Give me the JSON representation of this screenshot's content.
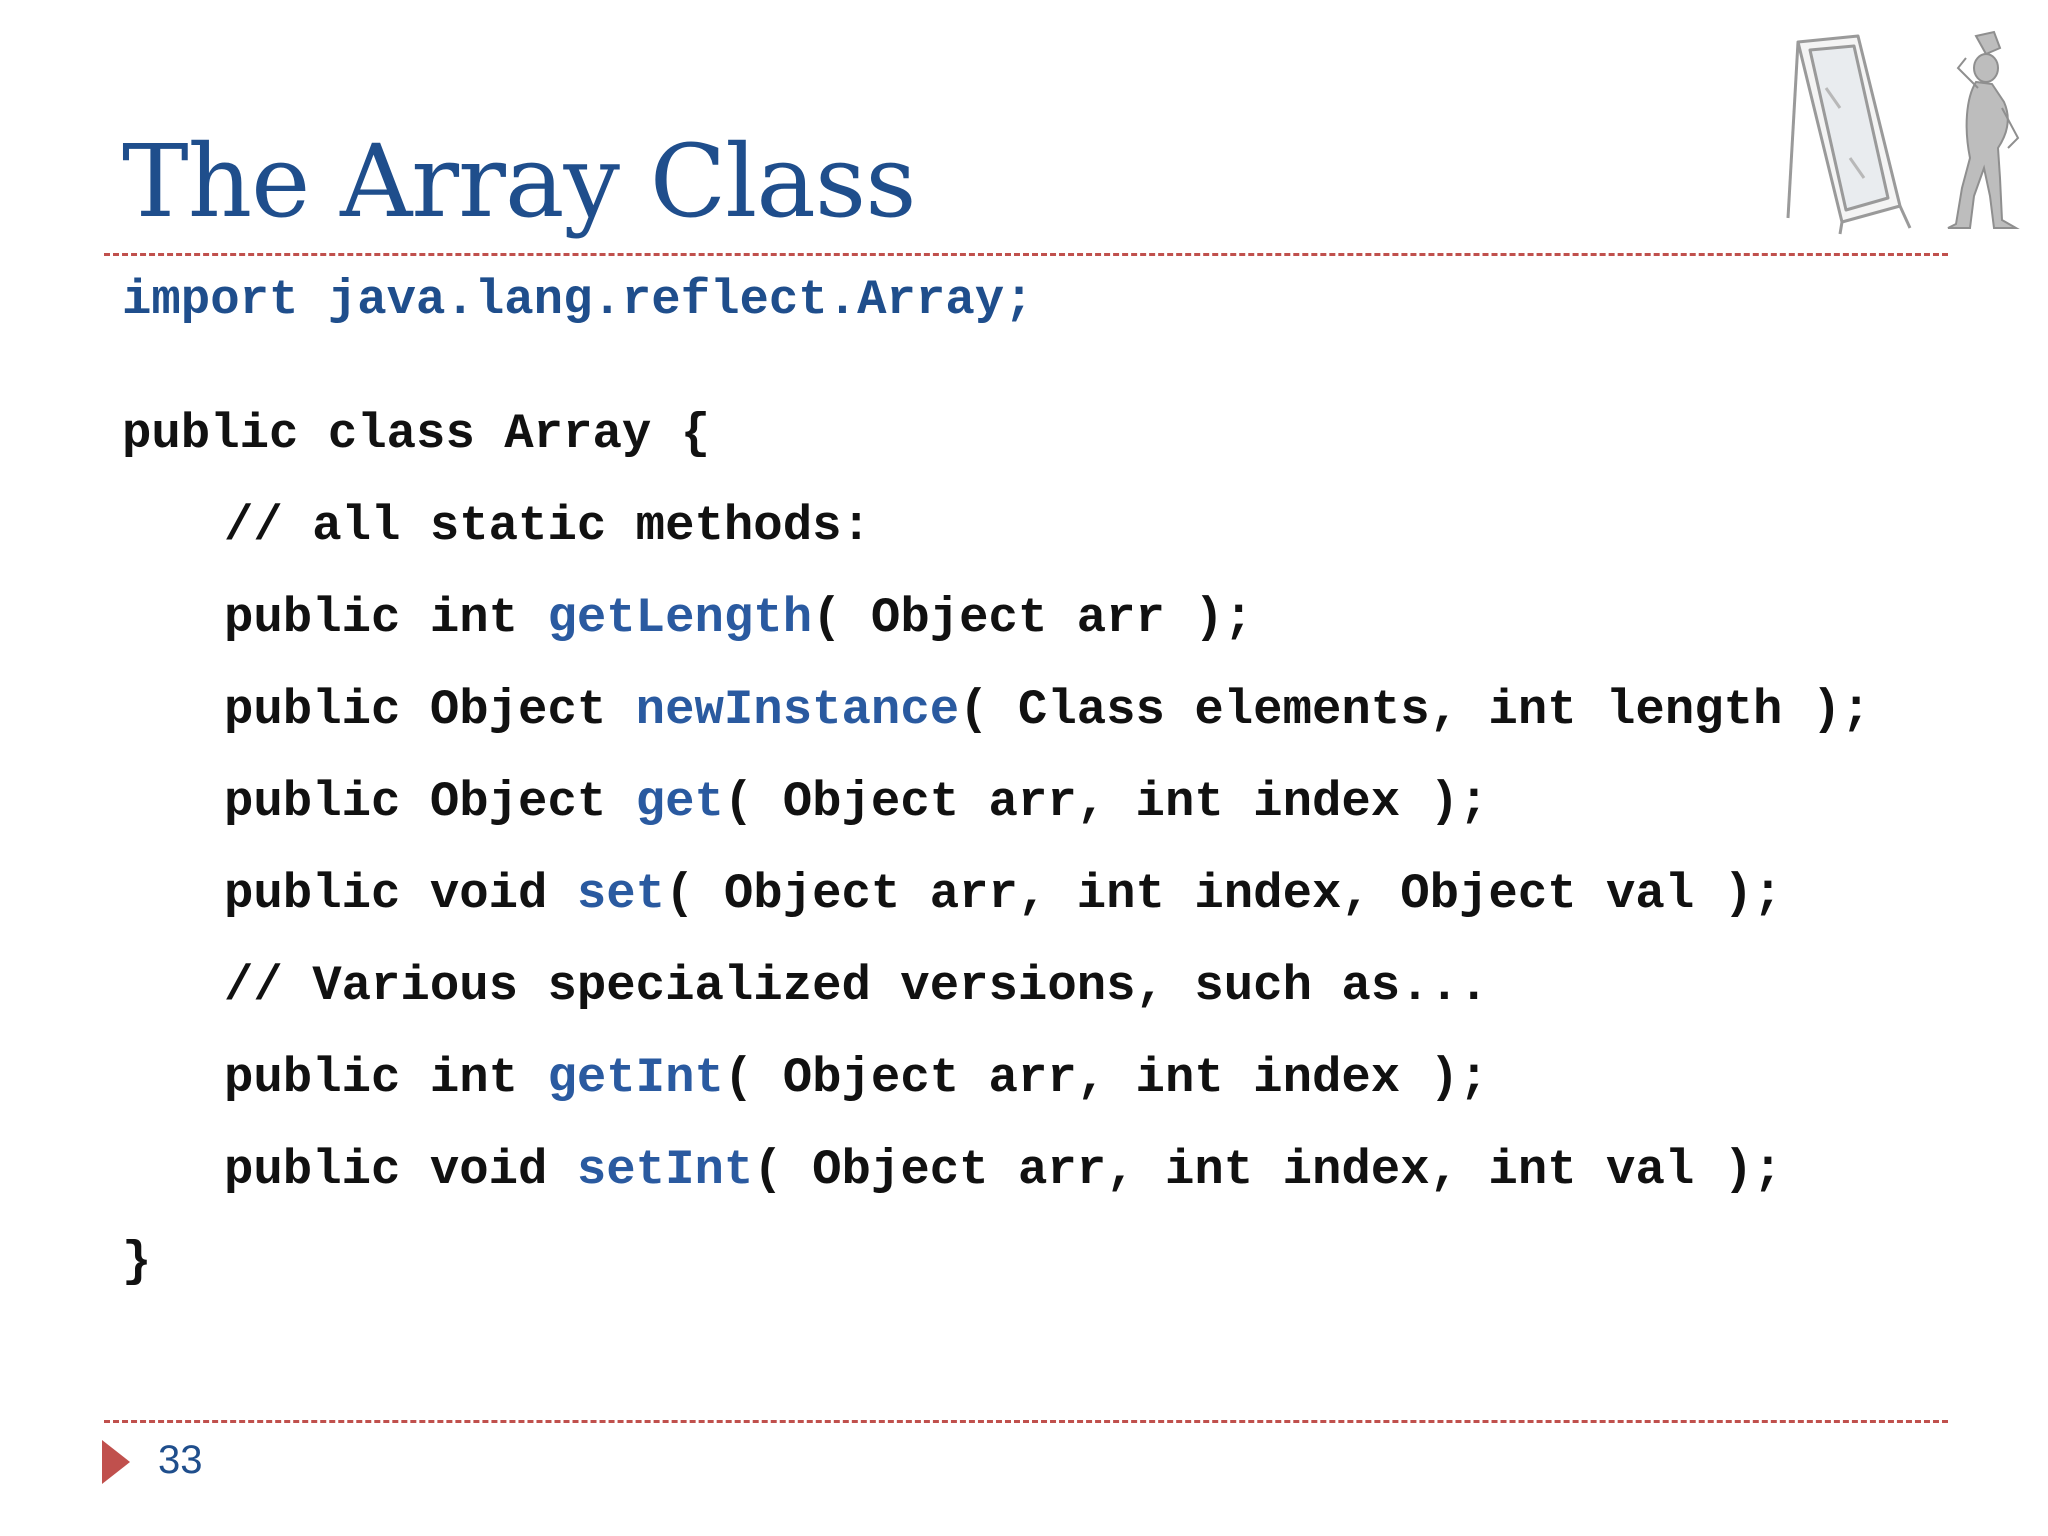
{
  "slide": {
    "title": "The Array Class",
    "page_number": "33"
  },
  "code": {
    "import_line": "import java.lang.reflect.Array;",
    "class_decl": "public class Array {",
    "comment_static": "// all static methods:",
    "methods": [
      {
        "prefix": "public int ",
        "name": "getLength",
        "params": "( Object arr );"
      },
      {
        "prefix": "public Object ",
        "name": "newInstance",
        "params": "( Class elements, int length );"
      },
      {
        "prefix": "public Object ",
        "name": "get",
        "params": "( Object arr, int index );"
      },
      {
        "prefix": "public void ",
        "name": "set",
        "params": "( Object arr, int index, Object val );"
      }
    ],
    "comment_specialized": "// Various specialized versions, such as...",
    "special_methods": [
      {
        "prefix": "public int ",
        "name": "getInt",
        "params": "( Object arr, int index );"
      },
      {
        "prefix": "public void ",
        "name": "setInt",
        "params": "( Object arr, int index, int val );"
      }
    ],
    "closing_brace": "}"
  },
  "colors": {
    "title": "#1f4e8c",
    "method_name": "#2a5aa0",
    "rule": "#c0504d",
    "code_text": "#111111"
  },
  "icons": {
    "clipart": "mirror-and-figure-icon",
    "footer_marker": "triangle-right-icon"
  }
}
